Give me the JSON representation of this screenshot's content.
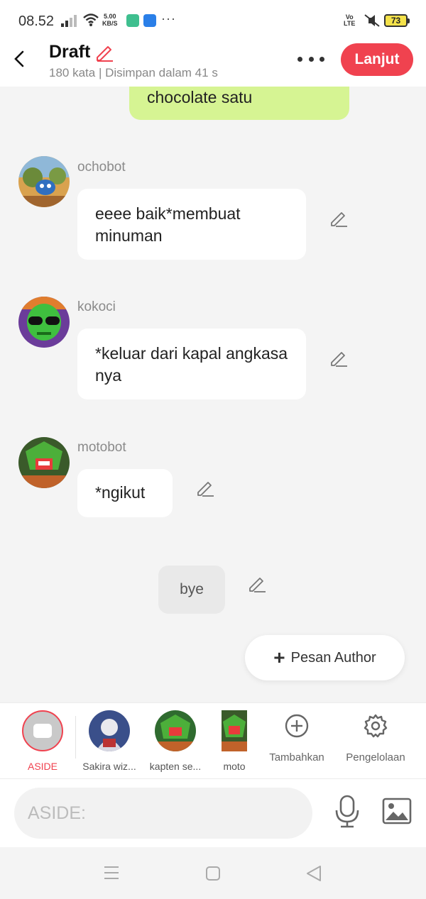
{
  "status_bar": {
    "time": "08.52",
    "speed_value": "5.00",
    "speed_unit": "KB/S",
    "volte_top": "Vo",
    "volte_bottom": "LTE",
    "battery": "73"
  },
  "header": {
    "title": "Draft",
    "subtitle": "180 kata | Disimpan dalam 41 s",
    "next_label": "Lanjut"
  },
  "chat": {
    "own_message": "chocolate satu",
    "messages": [
      {
        "sender": "ochobot",
        "text": "eeee baik*membuat minuman"
      },
      {
        "sender": "kokoci",
        "text": "*keluar dari kapal angkasa nya"
      },
      {
        "sender": "motobot",
        "text": "*ngikut"
      }
    ],
    "narration": "bye",
    "author_button": "Pesan Author"
  },
  "characters": [
    {
      "label": "ASIDE"
    },
    {
      "label": "Sakira wiz..."
    },
    {
      "label": "kapten se..."
    },
    {
      "label": "moto"
    }
  ],
  "tools": {
    "add_label": "Tambahkan",
    "manage_label": "Pengelolaan"
  },
  "input": {
    "placeholder": "ASIDE:"
  },
  "colors": {
    "accent": "#f0424f",
    "own_bubble": "#d6f493",
    "background": "#f4f4f4"
  }
}
